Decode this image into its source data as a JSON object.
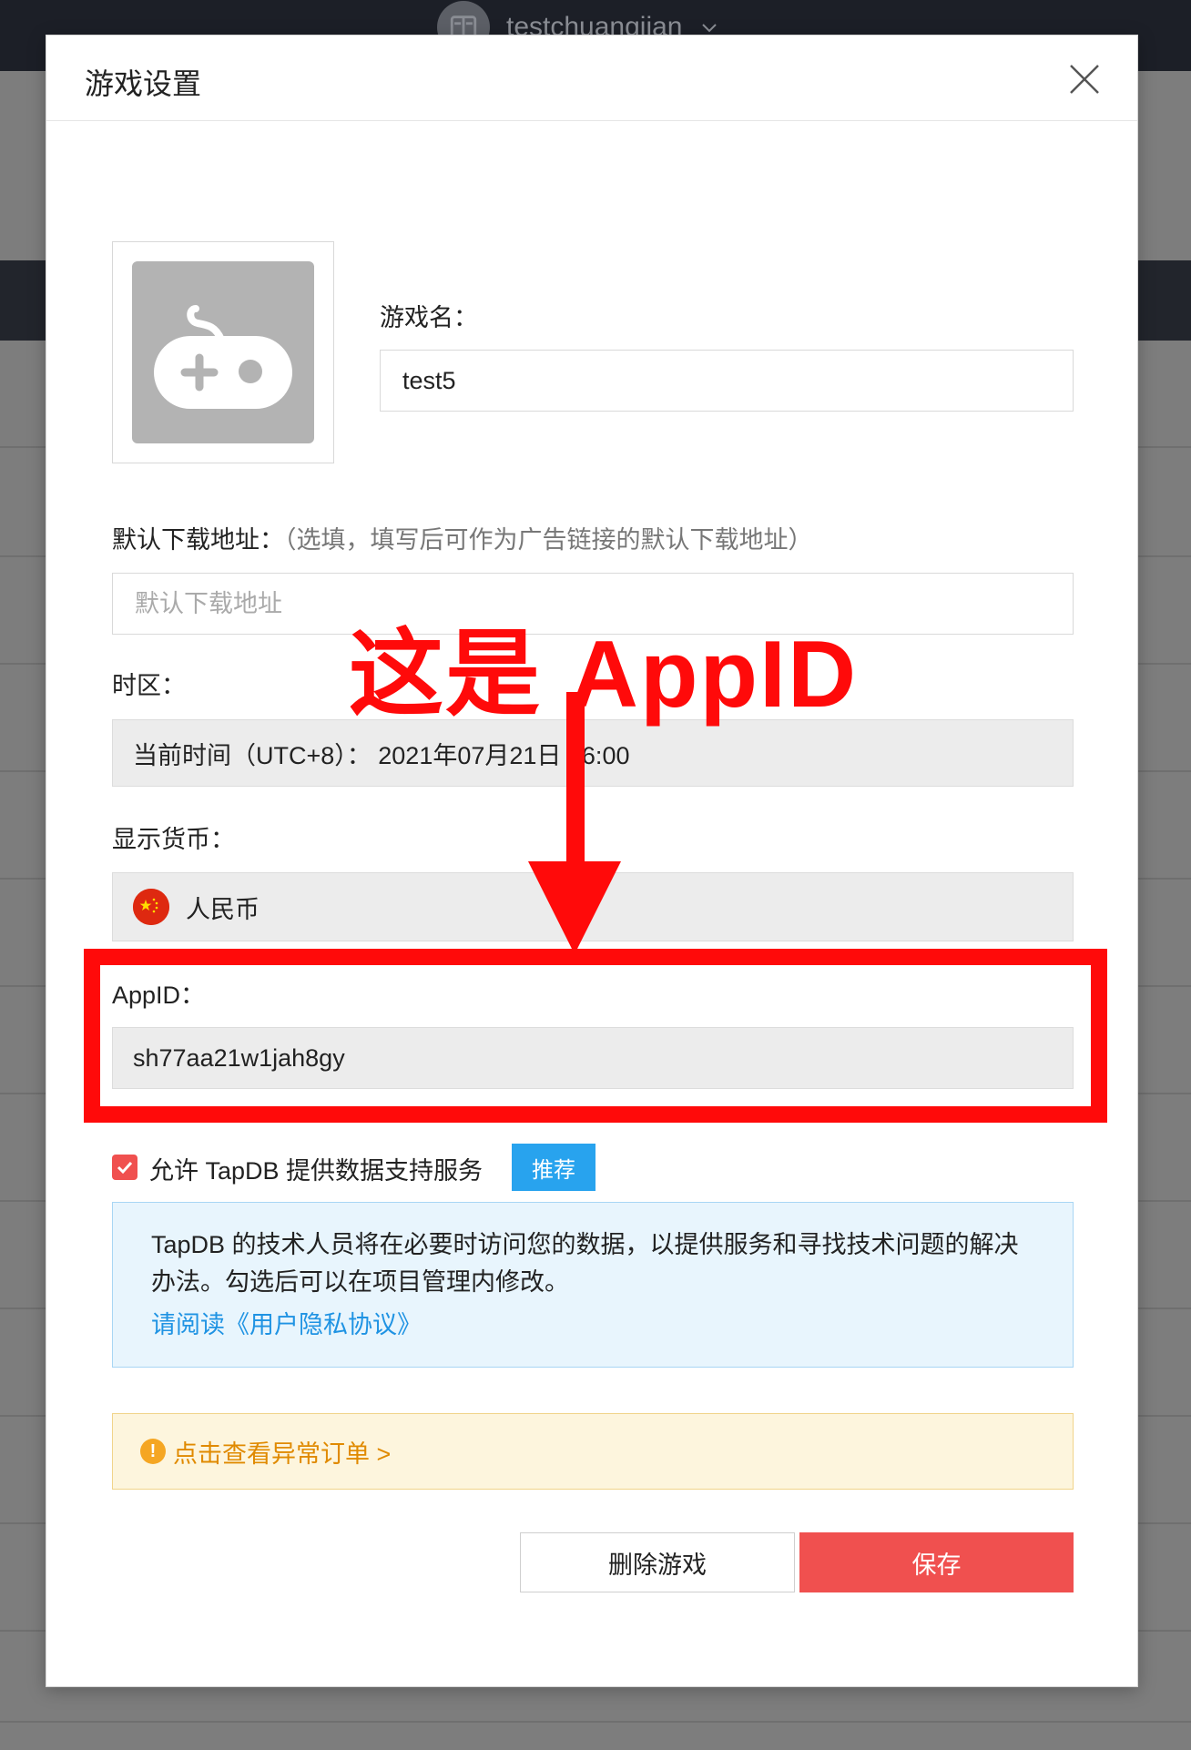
{
  "background": {
    "username": "testchuangjian"
  },
  "modal": {
    "title": "游戏设置",
    "game_name_label": "游戏名：",
    "game_name_value": "test5",
    "download_label": "默认下载地址：",
    "download_hint": "（选填，填写后可作为广告链接的默认下载地址）",
    "download_placeholder": "默认下载地址",
    "timezone_label": "时区：",
    "timezone_value": "当前时间（UTC+8）：  2021年07月21日 16:00",
    "currency_label": "显示货币：",
    "currency_value": "人民币",
    "appid_label": "AppID：",
    "appid_value": "sh77aa21w1jah8gy",
    "consent_label": "允许 TapDB 提供数据支持服务",
    "consent_checked": true,
    "recommend_badge": "推荐",
    "info_text": "TapDB 的技术人员将在必要时访问您的数据，以提供服务和寻找技术问题的解决办法。勾选后可以在项目管理内修改。",
    "info_link": "请阅读《用户隐私协议》",
    "warning_text": "点击查看异常订单 >",
    "delete_button": "删除游戏",
    "save_button": "保存"
  },
  "annotation": {
    "text": "这是 AppID",
    "color": "#ff0a0a"
  },
  "colors": {
    "primary_red": "#f0504f",
    "link_blue": "#1f93e3",
    "badge_blue": "#28a3ee",
    "warning_orange": "#e08a00"
  }
}
